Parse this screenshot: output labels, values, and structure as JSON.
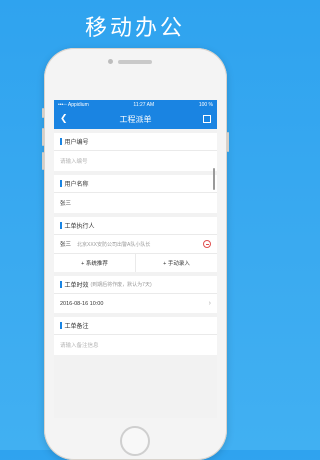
{
  "headline": "移动办公",
  "status_bar": {
    "carrier": "•••◦◦ Appidium",
    "time": "11:27 AM",
    "battery": "100 %"
  },
  "nav": {
    "title": "工程派单"
  },
  "sections": {
    "user_id": {
      "title": "用户编号",
      "placeholder": "请输入编号"
    },
    "user_name": {
      "title": "用户名称",
      "value": "张三"
    },
    "executor": {
      "title": "工单执行人",
      "name": "张三",
      "org": "北京XXX安防公司出警A队小队长",
      "btn_system": "+ 系统推荐",
      "btn_manual": "+ 手动录入"
    },
    "timeliness": {
      "title": "工单时效",
      "note": "(到期后将作废，默认为7天)",
      "value": "2016-08-16 10:00"
    },
    "remark": {
      "title": "工单备注",
      "placeholder": "请输入备注信息"
    }
  },
  "colors": {
    "accent": "#1a84e2",
    "background": "#2fa3ef",
    "danger": "#e05050"
  }
}
